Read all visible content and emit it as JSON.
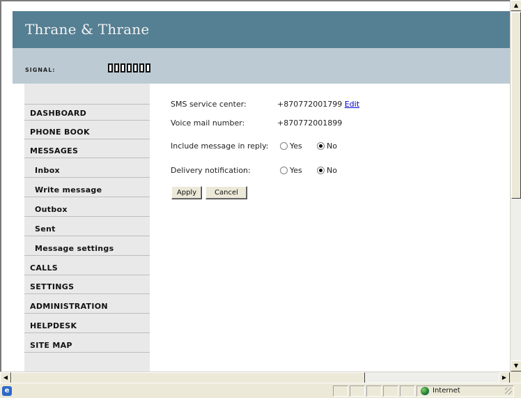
{
  "app": {
    "brand": "Thrane & Thrane",
    "signal_label": "SIGNAL:",
    "signal_bars_count": 7
  },
  "sidebar": {
    "items": [
      {
        "label": "DASHBOARD"
      },
      {
        "label": "PHONE BOOK"
      },
      {
        "label": "MESSAGES"
      },
      {
        "label": "Inbox"
      },
      {
        "label": "Write message"
      },
      {
        "label": "Outbox"
      },
      {
        "label": "Sent"
      },
      {
        "label": "Message settings"
      },
      {
        "label": "CALLS"
      },
      {
        "label": "SETTINGS"
      },
      {
        "label": "ADMINISTRATION"
      },
      {
        "label": "HELPDESK"
      },
      {
        "label": "SITE MAP"
      }
    ]
  },
  "settings": {
    "sms_center_label": "SMS service center:",
    "sms_center_value": "+870772001799",
    "edit_link": "Edit",
    "voicemail_label": "Voice mail number:",
    "voicemail_value": "+870772001899",
    "include_reply_label": "Include message in reply:",
    "include_reply_options": {
      "yes": "Yes",
      "no": "No",
      "selected": "No"
    },
    "delivery_label": "Delivery notification:",
    "delivery_options": {
      "yes": "Yes",
      "no": "No",
      "selected": "No"
    },
    "apply_label": "Apply",
    "cancel_label": "Cancel"
  },
  "statusbar": {
    "zone": "Internet"
  },
  "colors": {
    "header": "#557f93",
    "signal_bar": "#bccbd3",
    "sidebar": "#e9e9e9",
    "link": "#0000cc"
  }
}
